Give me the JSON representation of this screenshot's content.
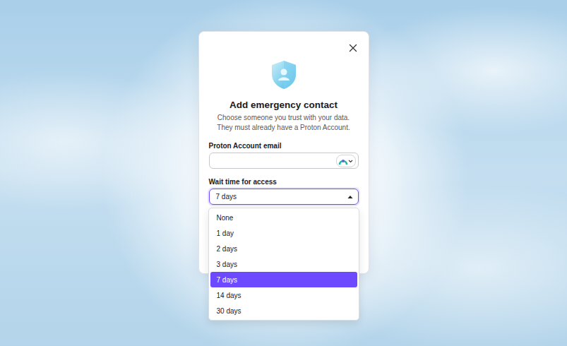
{
  "dialog": {
    "title": "Add emergency contact",
    "subtitle": "Choose someone you trust with your data. They must already have a Proton Account."
  },
  "email_field": {
    "label": "Proton Account email"
  },
  "wait_field": {
    "label": "Wait time for access",
    "value": "7 days",
    "expanded": true,
    "options": [
      {
        "label": "None",
        "selected": false
      },
      {
        "label": "1 day",
        "selected": false
      },
      {
        "label": "2 days",
        "selected": false
      },
      {
        "label": "3 days",
        "selected": false
      },
      {
        "label": "7 days",
        "selected": true
      },
      {
        "label": "14 days",
        "selected": false
      },
      {
        "label": "30 days",
        "selected": false
      }
    ]
  }
}
